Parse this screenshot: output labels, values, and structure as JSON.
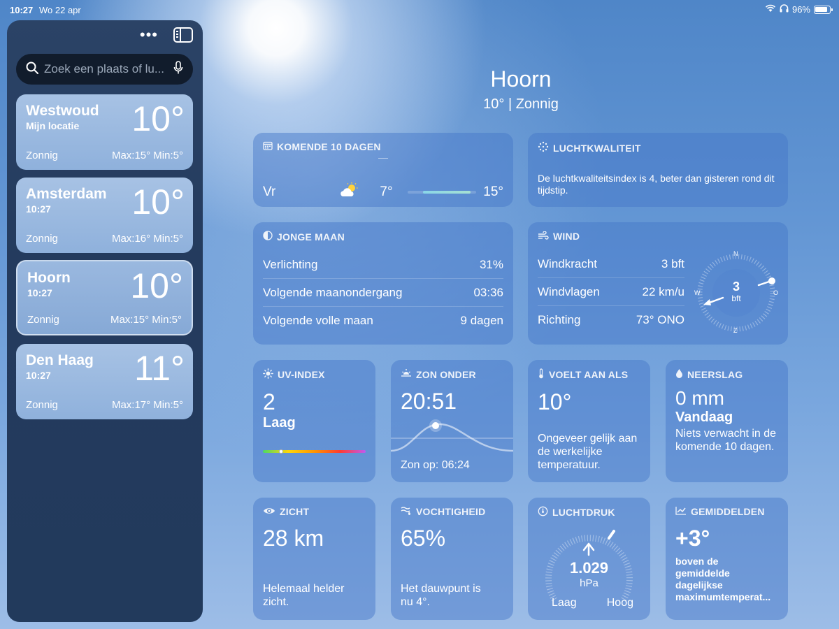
{
  "status": {
    "time": "10:27",
    "date": "Wo 22 apr",
    "battery": "96%"
  },
  "sidebar": {
    "search_placeholder": "Zoek een plaats of lu...",
    "locations": [
      {
        "name": "Westwoud",
        "sub": "Mijn locatie",
        "temp": "10°",
        "condition": "Zonnig",
        "minmax": "Max:15°  Min:5°"
      },
      {
        "name": "Amsterdam",
        "sub": "10:27",
        "temp": "10°",
        "condition": "Zonnig",
        "minmax": "Max:16°  Min:5°"
      },
      {
        "name": "Hoorn",
        "sub": "10:27",
        "temp": "10°",
        "condition": "Zonnig",
        "minmax": "Max:15°  Min:5°"
      },
      {
        "name": "Den Haag",
        "sub": "10:27",
        "temp": "11°",
        "condition": "Zonnig",
        "minmax": "Max:17°  Min:5°"
      }
    ]
  },
  "header": {
    "city": "Hoorn",
    "current": "10°  |  Zonnig"
  },
  "forecast": {
    "title": "KOMENDE 10 DAGEN",
    "day": "Vr",
    "low": "7°",
    "high": "15°"
  },
  "air": {
    "title": "LUCHTKWALITEIT",
    "text": "De luchtkwaliteitsindex is 4, beter dan gisteren rond dit tijdstip."
  },
  "moon": {
    "title": "JONGE MAAN",
    "rows": [
      {
        "label": "Verlichting",
        "value": "31%"
      },
      {
        "label": "Volgende maanondergang",
        "value": "03:36"
      },
      {
        "label": "Volgende volle maan",
        "value": "9 dagen"
      }
    ]
  },
  "wind": {
    "title": "WIND",
    "rows": [
      {
        "label": "Windkracht",
        "value": "3 bft"
      },
      {
        "label": "Windvlagen",
        "value": "22 km/u"
      },
      {
        "label": "Richting",
        "value": "73° ONO"
      }
    ],
    "compass": {
      "n": "N",
      "o": "O",
      "z": "Z",
      "w": "W",
      "value": "3",
      "unit": "bft"
    }
  },
  "uv": {
    "title": "UV-INDEX",
    "value": "2",
    "level": "Laag",
    "fraction": 0.18
  },
  "sunset": {
    "title": "ZON ONDER",
    "value": "20:51",
    "sunrise": "Zon op: 06:24"
  },
  "feels": {
    "title": "VOELT AAN ALS",
    "value": "10°",
    "text": "Ongeveer gelijk aan de werkelijke temperatuur."
  },
  "rain": {
    "title": "NEERSLAG",
    "value": "0 mm",
    "sub": "Vandaag",
    "text": "Niets verwacht in de komende 10 dagen."
  },
  "visibility": {
    "title": "ZICHT",
    "value": "28 km",
    "text": "Helemaal helder zicht."
  },
  "humidity": {
    "title": "VOCHTIGHEID",
    "value": "65%",
    "text": "Het dauwpunt is nu 4°."
  },
  "pressure": {
    "title": "LUCHTDRUK",
    "value": "1.029",
    "unit": "hPa",
    "low": "Laag",
    "high": "Hoog"
  },
  "averages": {
    "title": "GEMIDDELDEN",
    "value": "+3°",
    "text": "boven de gemiddelde dagelijkse maximumtemperat..."
  }
}
